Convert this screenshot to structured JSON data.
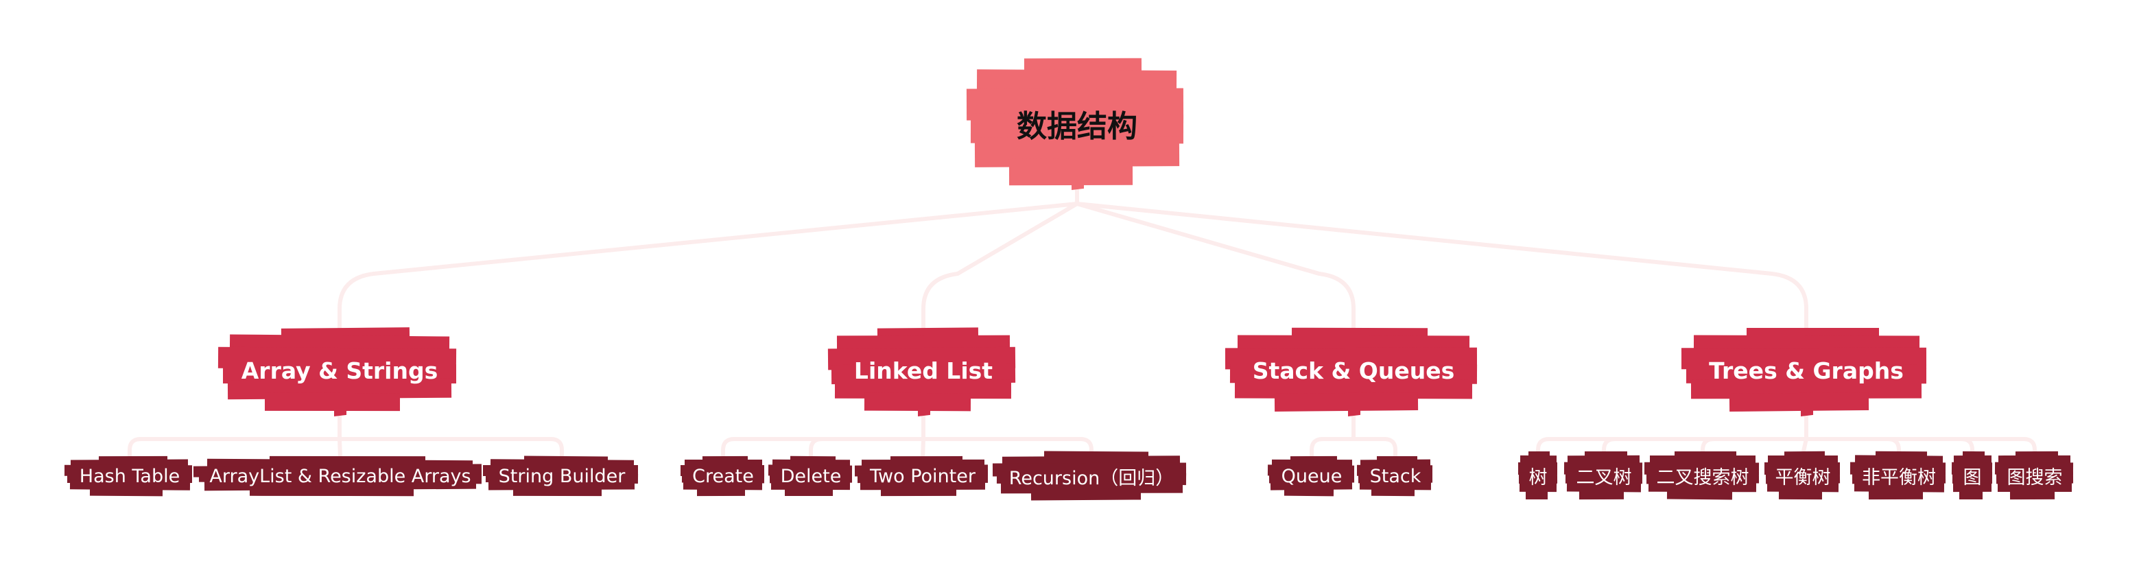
{
  "colors": {
    "root_fill": "#ef6b72",
    "topic_fill": "#cf2f49",
    "subtopic_fill": "#7c1c2b",
    "connector": "#fcecec",
    "background": "#ffffff"
  },
  "root": {
    "label": "数据结构"
  },
  "topics": [
    {
      "label": "Array & Strings",
      "children": [
        {
          "label": "Hash Table"
        },
        {
          "label": "ArrayList & Resizable Arrays"
        },
        {
          "label": "String Builder"
        }
      ]
    },
    {
      "label": "Linked List",
      "children": [
        {
          "label": "Create"
        },
        {
          "label": "Delete"
        },
        {
          "label": "Two Pointer"
        },
        {
          "label": "Recursion（回归）"
        }
      ]
    },
    {
      "label": "Stack & Queues",
      "children": [
        {
          "label": "Queue"
        },
        {
          "label": "Stack"
        }
      ]
    },
    {
      "label": "Trees & Graphs",
      "children": [
        {
          "label": "树"
        },
        {
          "label": "二叉树"
        },
        {
          "label": "二叉搜索树"
        },
        {
          "label": "平衡树"
        },
        {
          "label": "非平衡树"
        },
        {
          "label": "图"
        },
        {
          "label": "图搜索"
        }
      ]
    }
  ]
}
